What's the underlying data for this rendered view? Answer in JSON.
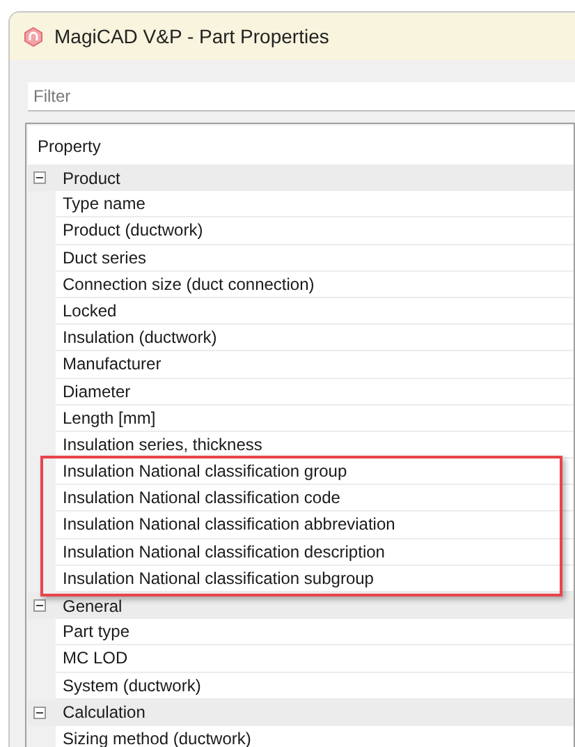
{
  "window": {
    "title": "MagiCAD V&P - Part Properties"
  },
  "filter": {
    "placeholder": "Filter"
  },
  "grid": {
    "header": "Property",
    "groups": [
      {
        "label": "Product",
        "expanded": true,
        "children": [
          {
            "label": "Type name",
            "highlighted": false
          },
          {
            "label": "Product (ductwork)",
            "highlighted": false
          },
          {
            "label": "Duct series",
            "highlighted": false
          },
          {
            "label": "Connection size (duct connection)",
            "highlighted": false
          },
          {
            "label": "Locked",
            "highlighted": false
          },
          {
            "label": "Insulation (ductwork)",
            "highlighted": false
          },
          {
            "label": "Manufacturer",
            "highlighted": false
          },
          {
            "label": "Diameter",
            "highlighted": false
          },
          {
            "label": "Length [mm]",
            "highlighted": false
          },
          {
            "label": "Insulation series, thickness",
            "highlighted": false
          },
          {
            "label": "Insulation National classification group",
            "highlighted": true
          },
          {
            "label": "Insulation National classification code",
            "highlighted": true
          },
          {
            "label": "Insulation National classification abbreviation",
            "highlighted": true
          },
          {
            "label": "Insulation National classification description",
            "highlighted": true
          },
          {
            "label": "Insulation National classification subgroup",
            "highlighted": true
          }
        ]
      },
      {
        "label": "General",
        "expanded": true,
        "children": [
          {
            "label": "Part type",
            "highlighted": false
          },
          {
            "label": "MC LOD",
            "highlighted": false
          },
          {
            "label": "System (ductwork)",
            "highlighted": false
          }
        ]
      },
      {
        "label": "Calculation",
        "expanded": true,
        "children": [
          {
            "label": "Sizing method (ductwork)",
            "highlighted": false
          }
        ]
      }
    ]
  }
}
